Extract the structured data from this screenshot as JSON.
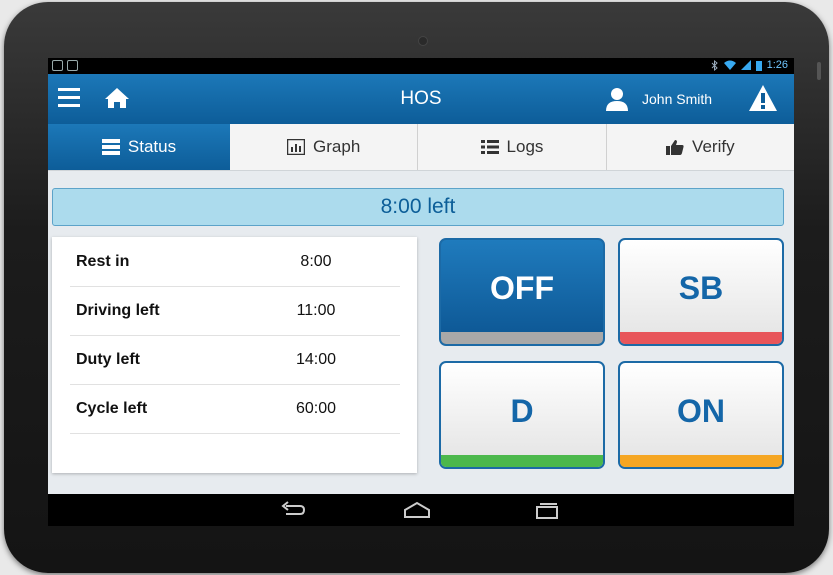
{
  "status_bar": {
    "time": "1:26"
  },
  "app_bar": {
    "title": "HOS",
    "user_name": "John Smith"
  },
  "tabs": [
    {
      "label": "Status",
      "icon": "status-icon",
      "active": true
    },
    {
      "label": "Graph",
      "icon": "bar-chart-icon",
      "active": false
    },
    {
      "label": "Logs",
      "icon": "list-icon",
      "active": false
    },
    {
      "label": "Verify",
      "icon": "thumbs-up-icon",
      "active": false
    }
  ],
  "banner": {
    "text": "8:00 left"
  },
  "summary": [
    {
      "label": "Rest in",
      "value": "8:00"
    },
    {
      "label": "Driving left",
      "value": "11:00"
    },
    {
      "label": "Duty left",
      "value": "14:00"
    },
    {
      "label": "Cycle left",
      "value": "60:00"
    }
  ],
  "duty_buttons": [
    {
      "label": "OFF",
      "strip_color": "#a8a8a8",
      "selected": true
    },
    {
      "label": "SB",
      "strip_color": "#e8555a",
      "selected": false
    },
    {
      "label": "D",
      "strip_color": "#4cb84c",
      "selected": false
    },
    {
      "label": "ON",
      "strip_color": "#f5a623",
      "selected": false
    }
  ],
  "colors": {
    "primary": "#1466a8",
    "banner_bg": "#acdbed"
  }
}
